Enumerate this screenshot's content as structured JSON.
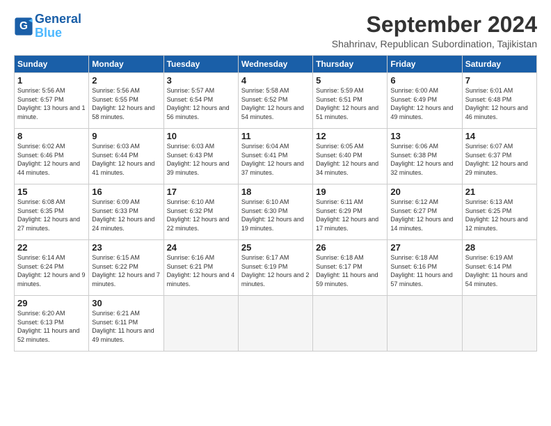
{
  "header": {
    "logo_line1": "General",
    "logo_line2": "Blue",
    "title": "September 2024",
    "subtitle": "Shahrinav, Republican Subordination, Tajikistan"
  },
  "days_of_week": [
    "Sunday",
    "Monday",
    "Tuesday",
    "Wednesday",
    "Thursday",
    "Friday",
    "Saturday"
  ],
  "weeks": [
    [
      {
        "day": "1",
        "sunrise": "5:56 AM",
        "sunset": "6:57 PM",
        "daylight": "13 hours and 1 minute."
      },
      {
        "day": "2",
        "sunrise": "5:56 AM",
        "sunset": "6:55 PM",
        "daylight": "12 hours and 58 minutes."
      },
      {
        "day": "3",
        "sunrise": "5:57 AM",
        "sunset": "6:54 PM",
        "daylight": "12 hours and 56 minutes."
      },
      {
        "day": "4",
        "sunrise": "5:58 AM",
        "sunset": "6:52 PM",
        "daylight": "12 hours and 54 minutes."
      },
      {
        "day": "5",
        "sunrise": "5:59 AM",
        "sunset": "6:51 PM",
        "daylight": "12 hours and 51 minutes."
      },
      {
        "day": "6",
        "sunrise": "6:00 AM",
        "sunset": "6:49 PM",
        "daylight": "12 hours and 49 minutes."
      },
      {
        "day": "7",
        "sunrise": "6:01 AM",
        "sunset": "6:48 PM",
        "daylight": "12 hours and 46 minutes."
      }
    ],
    [
      {
        "day": "8",
        "sunrise": "6:02 AM",
        "sunset": "6:46 PM",
        "daylight": "12 hours and 44 minutes."
      },
      {
        "day": "9",
        "sunrise": "6:03 AM",
        "sunset": "6:44 PM",
        "daylight": "12 hours and 41 minutes."
      },
      {
        "day": "10",
        "sunrise": "6:03 AM",
        "sunset": "6:43 PM",
        "daylight": "12 hours and 39 minutes."
      },
      {
        "day": "11",
        "sunrise": "6:04 AM",
        "sunset": "6:41 PM",
        "daylight": "12 hours and 37 minutes."
      },
      {
        "day": "12",
        "sunrise": "6:05 AM",
        "sunset": "6:40 PM",
        "daylight": "12 hours and 34 minutes."
      },
      {
        "day": "13",
        "sunrise": "6:06 AM",
        "sunset": "6:38 PM",
        "daylight": "12 hours and 32 minutes."
      },
      {
        "day": "14",
        "sunrise": "6:07 AM",
        "sunset": "6:37 PM",
        "daylight": "12 hours and 29 minutes."
      }
    ],
    [
      {
        "day": "15",
        "sunrise": "6:08 AM",
        "sunset": "6:35 PM",
        "daylight": "12 hours and 27 minutes."
      },
      {
        "day": "16",
        "sunrise": "6:09 AM",
        "sunset": "6:33 PM",
        "daylight": "12 hours and 24 minutes."
      },
      {
        "day": "17",
        "sunrise": "6:10 AM",
        "sunset": "6:32 PM",
        "daylight": "12 hours and 22 minutes."
      },
      {
        "day": "18",
        "sunrise": "6:10 AM",
        "sunset": "6:30 PM",
        "daylight": "12 hours and 19 minutes."
      },
      {
        "day": "19",
        "sunrise": "6:11 AM",
        "sunset": "6:29 PM",
        "daylight": "12 hours and 17 minutes."
      },
      {
        "day": "20",
        "sunrise": "6:12 AM",
        "sunset": "6:27 PM",
        "daylight": "12 hours and 14 minutes."
      },
      {
        "day": "21",
        "sunrise": "6:13 AM",
        "sunset": "6:25 PM",
        "daylight": "12 hours and 12 minutes."
      }
    ],
    [
      {
        "day": "22",
        "sunrise": "6:14 AM",
        "sunset": "6:24 PM",
        "daylight": "12 hours and 9 minutes."
      },
      {
        "day": "23",
        "sunrise": "6:15 AM",
        "sunset": "6:22 PM",
        "daylight": "12 hours and 7 minutes."
      },
      {
        "day": "24",
        "sunrise": "6:16 AM",
        "sunset": "6:21 PM",
        "daylight": "12 hours and 4 minutes."
      },
      {
        "day": "25",
        "sunrise": "6:17 AM",
        "sunset": "6:19 PM",
        "daylight": "12 hours and 2 minutes."
      },
      {
        "day": "26",
        "sunrise": "6:18 AM",
        "sunset": "6:17 PM",
        "daylight": "11 hours and 59 minutes."
      },
      {
        "day": "27",
        "sunrise": "6:18 AM",
        "sunset": "6:16 PM",
        "daylight": "11 hours and 57 minutes."
      },
      {
        "day": "28",
        "sunrise": "6:19 AM",
        "sunset": "6:14 PM",
        "daylight": "11 hours and 54 minutes."
      }
    ],
    [
      {
        "day": "29",
        "sunrise": "6:20 AM",
        "sunset": "6:13 PM",
        "daylight": "11 hours and 52 minutes."
      },
      {
        "day": "30",
        "sunrise": "6:21 AM",
        "sunset": "6:11 PM",
        "daylight": "11 hours and 49 minutes."
      },
      null,
      null,
      null,
      null,
      null
    ]
  ]
}
